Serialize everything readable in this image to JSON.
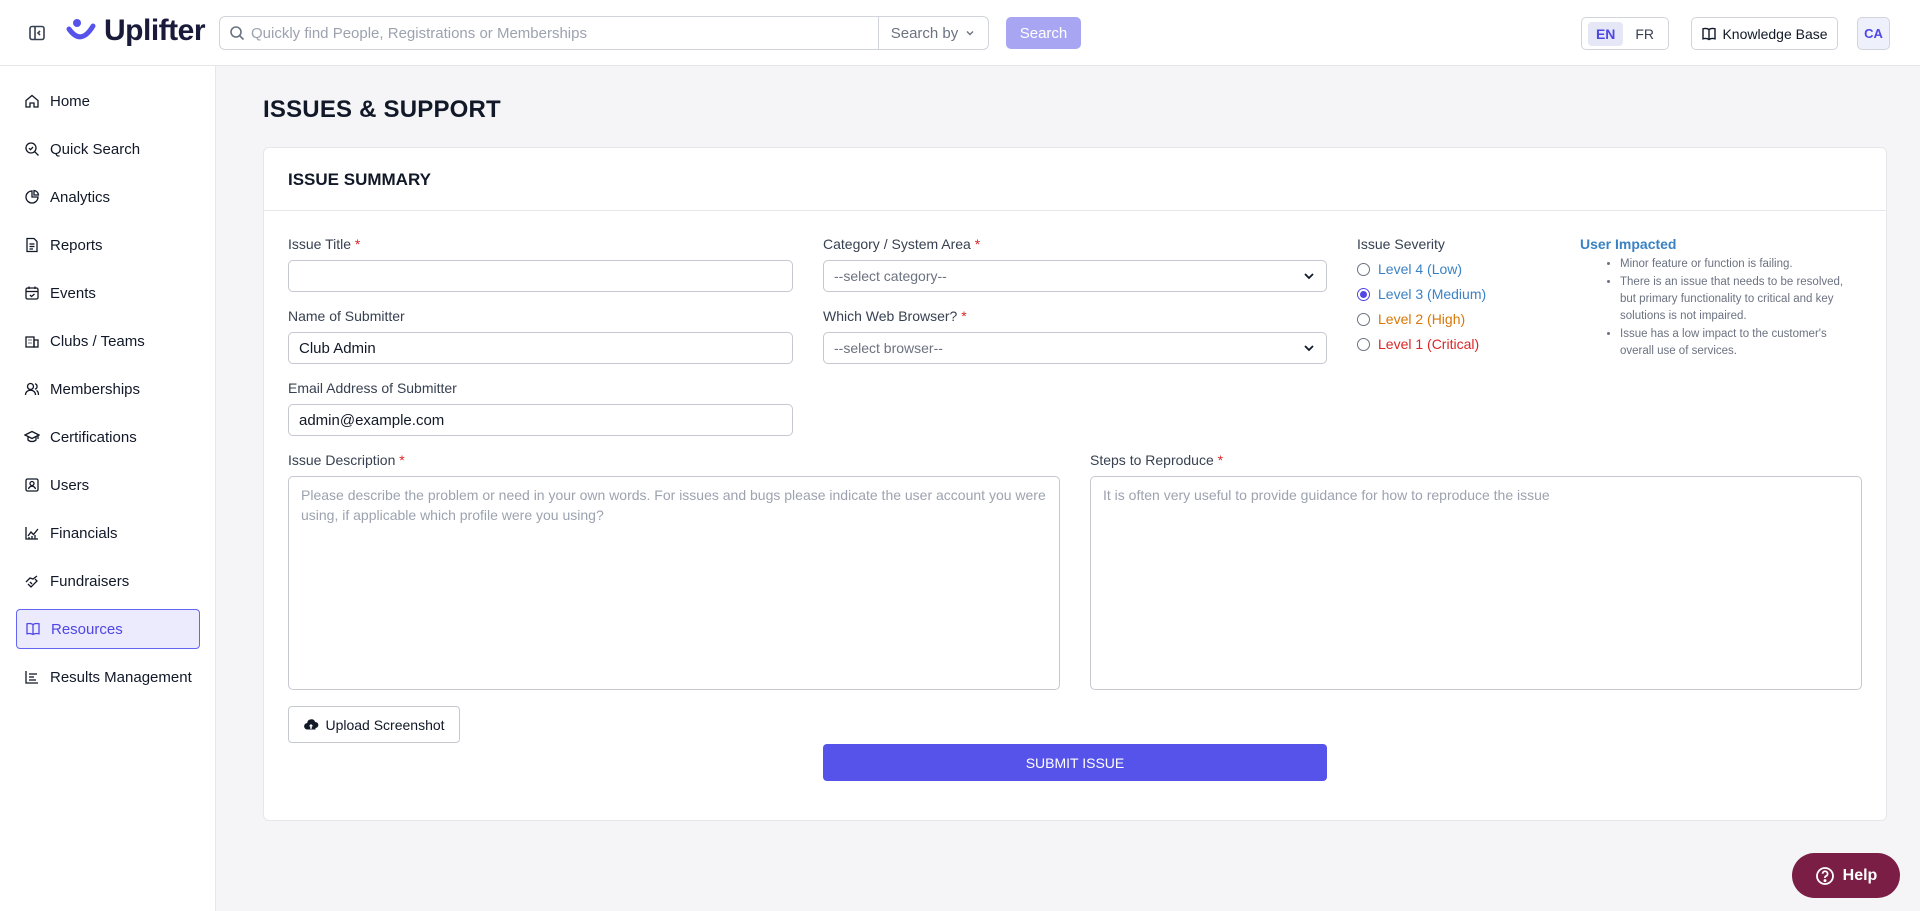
{
  "header": {
    "logo_text": "Uplifter",
    "search_placeholder": "Quickly find People, Registrations or Memberships",
    "search_by_label": "Search by",
    "search_button": "Search",
    "lang_en": "EN",
    "lang_fr": "FR",
    "knowledge_base": "Knowledge Base",
    "avatar_initials": "CA"
  },
  "sidebar": {
    "items": [
      {
        "label": "Home",
        "icon": "home-icon"
      },
      {
        "label": "Quick Search",
        "icon": "search-icon"
      },
      {
        "label": "Analytics",
        "icon": "pie-chart-icon"
      },
      {
        "label": "Reports",
        "icon": "document-icon"
      },
      {
        "label": "Events",
        "icon": "calendar-icon"
      },
      {
        "label": "Clubs / Teams",
        "icon": "building-icon"
      },
      {
        "label": "Memberships",
        "icon": "user-group-icon"
      },
      {
        "label": "Certifications",
        "icon": "graduation-cap-icon"
      },
      {
        "label": "Users",
        "icon": "user-card-icon"
      },
      {
        "label": "Financials",
        "icon": "line-chart-icon"
      },
      {
        "label": "Fundraisers",
        "icon": "handshake-icon"
      },
      {
        "label": "Resources",
        "icon": "book-icon",
        "active": true
      },
      {
        "label": "Results Management",
        "icon": "bar-chart-icon"
      }
    ]
  },
  "page": {
    "title": "ISSUES & SUPPORT",
    "card_title": "ISSUE SUMMARY"
  },
  "form": {
    "issue_title_label": "Issue Title",
    "issue_title_value": "",
    "submitter_name_label": "Name of Submitter",
    "submitter_name_value": "Club Admin",
    "submitter_email_label": "Email Address of Submitter",
    "submitter_email_value": "admin@example.com",
    "category_label": "Category / System Area",
    "category_value": "--select category--",
    "browser_label": "Which Web Browser?",
    "browser_value": "--select browser--",
    "required_mark": "*",
    "severity_label": "Issue Severity",
    "severity_options": [
      {
        "label": "Level 4 (Low)",
        "color": "#3b82c4",
        "checked": false
      },
      {
        "label": "Level 3 (Medium)",
        "color": "#3b82c4",
        "checked": true
      },
      {
        "label": "Level 2 (High)",
        "color": "#d97706",
        "checked": false
      },
      {
        "label": "Level 1 (Critical)",
        "color": "#dc2626",
        "checked": false
      }
    ],
    "impact_title": "User Impacted",
    "impact_items": [
      "Minor feature or function is failing.",
      "There is an issue that needs to be resolved, but primary functionality to critical and key solutions is not impaired.",
      "Issue has a low impact to the customer's overall use of services."
    ],
    "description_label": "Issue Description",
    "description_placeholder": "Please describe the problem or need in your own words. For issues and bugs please indicate the user account you were using, if applicable which profile were you using?",
    "steps_label": "Steps to Reproduce",
    "steps_placeholder": "It is often very useful to provide guidance for how to reproduce the issue",
    "upload_button": "Upload Screenshot",
    "submit_button": "SUBMIT ISSUE"
  },
  "help_button": "Help",
  "colors": {
    "accent": "#5553ea",
    "help_bg": "#7a1e45",
    "required": "#dc2626"
  }
}
